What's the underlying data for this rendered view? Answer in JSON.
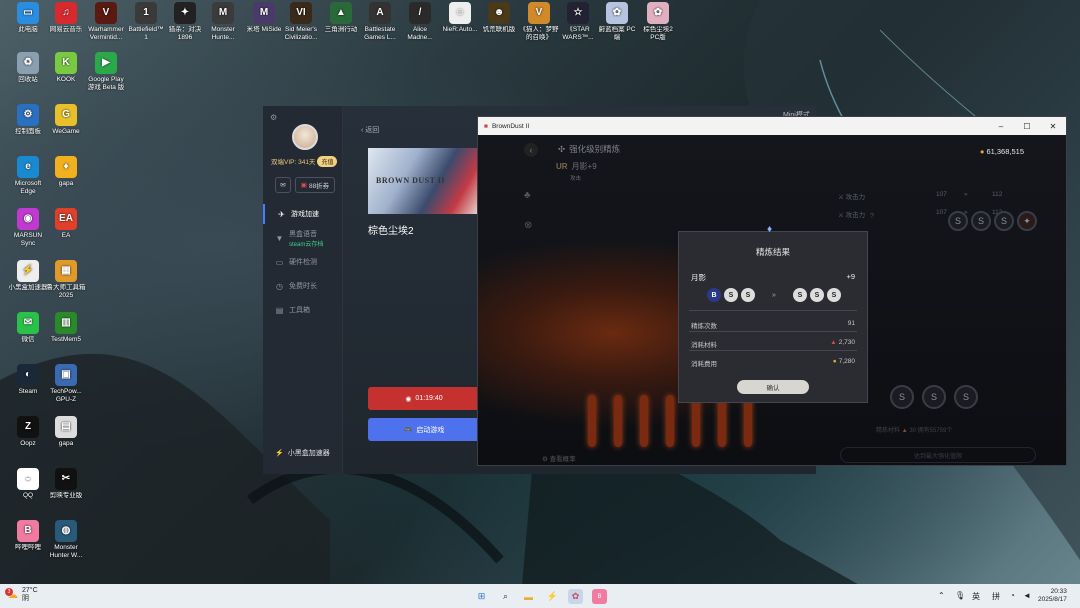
{
  "desktop_icons": [
    {
      "label": "此电脑",
      "color": "#2a8de0",
      "glyph": "▭"
    },
    {
      "label": "网易云音乐",
      "color": "#d8292e",
      "glyph": "♫"
    },
    {
      "label": "Warhammer Vermintid...",
      "color": "#5a1a12",
      "glyph": "V"
    },
    {
      "label": "Battlefield™ 1",
      "color": "#3a3a3a",
      "glyph": "1"
    },
    {
      "label": "猎杀：对决 1896",
      "color": "#222",
      "glyph": "✦"
    },
    {
      "label": "Monster Hunte...",
      "color": "#3b3b3b",
      "glyph": "M"
    },
    {
      "label": "米塔 MiSide",
      "color": "#4a3a6a",
      "glyph": "M"
    },
    {
      "label": "Sid Meier's Civilizatio...",
      "color": "#3a2a1a",
      "glyph": "VI"
    },
    {
      "label": "三角洲行动",
      "color": "#2a6a3a",
      "glyph": "▲"
    },
    {
      "label": "Battlestate Games L...",
      "color": "#333",
      "glyph": "A"
    },
    {
      "label": "Alice Madne...",
      "color": "#2a2a2a",
      "glyph": "/"
    },
    {
      "label": "NieR:Auto...",
      "color": "#eee",
      "glyph": "☺"
    },
    {
      "label": "饥荒联机版",
      "color": "#4a3a1a",
      "glyph": "☻"
    },
    {
      "label": "《猫人：梦野的召唤》",
      "color": "#d08a2a",
      "glyph": "V"
    },
    {
      "label": "《STAR WARS™...",
      "color": "#223",
      "glyph": "☆"
    },
    {
      "label": "蔚蓝档案 PC端",
      "color": "#b6c4e0",
      "glyph": "✿"
    },
    {
      "label": "棕色尘埃2 PC版",
      "color": "#e0b0c0",
      "glyph": "✿"
    },
    {
      "label": "回收站",
      "color": "#8aa0b0",
      "glyph": "♻"
    },
    {
      "label": "KOOK",
      "color": "#7ac943",
      "glyph": "K"
    },
    {
      "label": "Google Play 游戏 Beta 版",
      "color": "#2aa84a",
      "glyph": "▶"
    },
    {
      "label": "控制面板",
      "color": "#2a70c0",
      "glyph": "⚙"
    },
    {
      "label": "WeGame",
      "color": "#e8c02a",
      "glyph": "G"
    },
    {
      "label": "Microsoft Edge",
      "color": "#1a8ad0",
      "glyph": "e"
    },
    {
      "label": "gapa",
      "color": "#f0b020",
      "glyph": "♦"
    },
    {
      "label": "MARSUN Sync",
      "color": "#c03ad0",
      "glyph": "◉"
    },
    {
      "label": "EA",
      "color": "#e0402a",
      "glyph": "EA"
    },
    {
      "label": "小黑盒加速器",
      "color": "#eee",
      "glyph": "⚡"
    },
    {
      "label": "鲁大师工具箱2025",
      "color": "#e09a2a",
      "glyph": "▦"
    },
    {
      "label": "微信",
      "color": "#2ac14a",
      "glyph": "✉"
    },
    {
      "label": "TestMem5",
      "color": "#2a8a2a",
      "glyph": "▥"
    },
    {
      "label": "Steam",
      "color": "#1b2838",
      "glyph": "◐"
    },
    {
      "label": "TechPow... GPU-Z",
      "color": "#3a6ab0",
      "glyph": "▣"
    },
    {
      "label": "Oopz",
      "color": "#111",
      "glyph": "Z"
    },
    {
      "label": "gapa",
      "color": "#ddd",
      "glyph": "▤"
    },
    {
      "label": "QQ",
      "color": "#fff",
      "glyph": "◒"
    },
    {
      "label": "剪映专业版",
      "color": "#111",
      "glyph": "✂"
    },
    {
      "label": "哔哩哔哩",
      "color": "#f07aa0",
      "glyph": "B"
    },
    {
      "label": "Monster Hunter W...",
      "color": "#2a5a7a",
      "glyph": "◍"
    }
  ],
  "acc": {
    "vip": "双端VIP: 341天",
    "renew": "充值",
    "coupon": "88折券",
    "nav": [
      {
        "label": "游戏加速",
        "glyph": "✈",
        "active": true
      },
      {
        "label": "黑盒语音",
        "sub": "steam云存档",
        "glyph": "▼"
      },
      {
        "label": "硬件检测",
        "glyph": "▭"
      },
      {
        "label": "免费时长",
        "glyph": "◷"
      },
      {
        "label": "工具箱",
        "glyph": "▤"
      }
    ],
    "brand": "小黑盒加速器",
    "back": "返回",
    "game_name": "棕色尘埃2",
    "cover_logo": "BROWN DUST II",
    "timer": "01:19:40",
    "launch": "启动游戏",
    "mini": "Mini模式"
  },
  "bd": {
    "title": "BrownDust II",
    "header": "强化级别精炼",
    "char_name": "月影+9",
    "char_rank": "UR",
    "sub_small": "攻击",
    "gold": "61,368,515",
    "stats": [
      {
        "label": "攻击力",
        "from": "107",
        "to": "112"
      },
      {
        "label": "攻击力",
        "from": "107",
        "to": "112"
      }
    ],
    "bottom_text": "精炼材料",
    "bottom_count": "30",
    "bottom_hint": "拥有55759个",
    "view_prob": "查看概率",
    "bottom_btn": "达到最大强化值限",
    "modal": {
      "title": "精炼结果",
      "char": "月影",
      "level": "+9",
      "rows": [
        {
          "label": "精炼次数",
          "value": "91"
        },
        {
          "label": "消耗材料",
          "value": "2,730"
        },
        {
          "label": "消耗费用",
          "value": "7,280"
        }
      ],
      "confirm": "确认"
    }
  },
  "taskbar": {
    "weather_temp": "27°C",
    "weather_desc": "阴",
    "weather_badge": "3",
    "ime_lang": "英",
    "ime_mode": "拼",
    "time": "20:33",
    "date": "2025/8/17"
  }
}
